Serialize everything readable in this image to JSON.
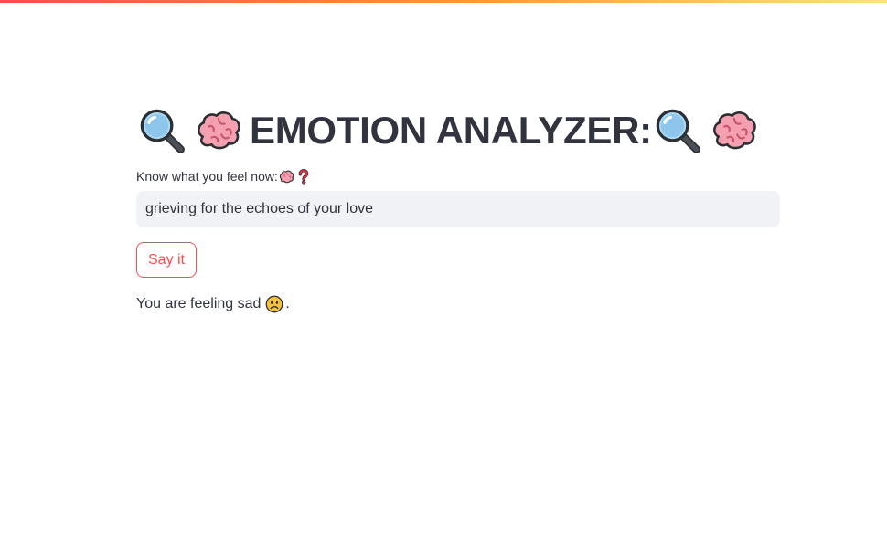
{
  "header": {
    "title": "EMOTION ANALYZER:",
    "accent_gradient": [
      "#ff4b4b",
      "#ff9a3c",
      "#ffe08a"
    ]
  },
  "title_icons": {
    "left": [
      "magnifying-glass-icon",
      "brain-icon"
    ],
    "right": [
      "magnifying-glass-icon",
      "brain-icon"
    ]
  },
  "input_section": {
    "label": "Know what you feel now:",
    "label_icons": [
      "brain-icon",
      "question-mark-icon"
    ],
    "value": "grieving for the echoes of your love"
  },
  "actions": {
    "submit_label": "Say it"
  },
  "result": {
    "prefix": "You are feeling sad",
    "icon": "sad-face-icon",
    "suffix": "."
  },
  "colors": {
    "primary": "#ff4b4b",
    "text": "#31333f",
    "input_background": "#f0f2f6"
  }
}
